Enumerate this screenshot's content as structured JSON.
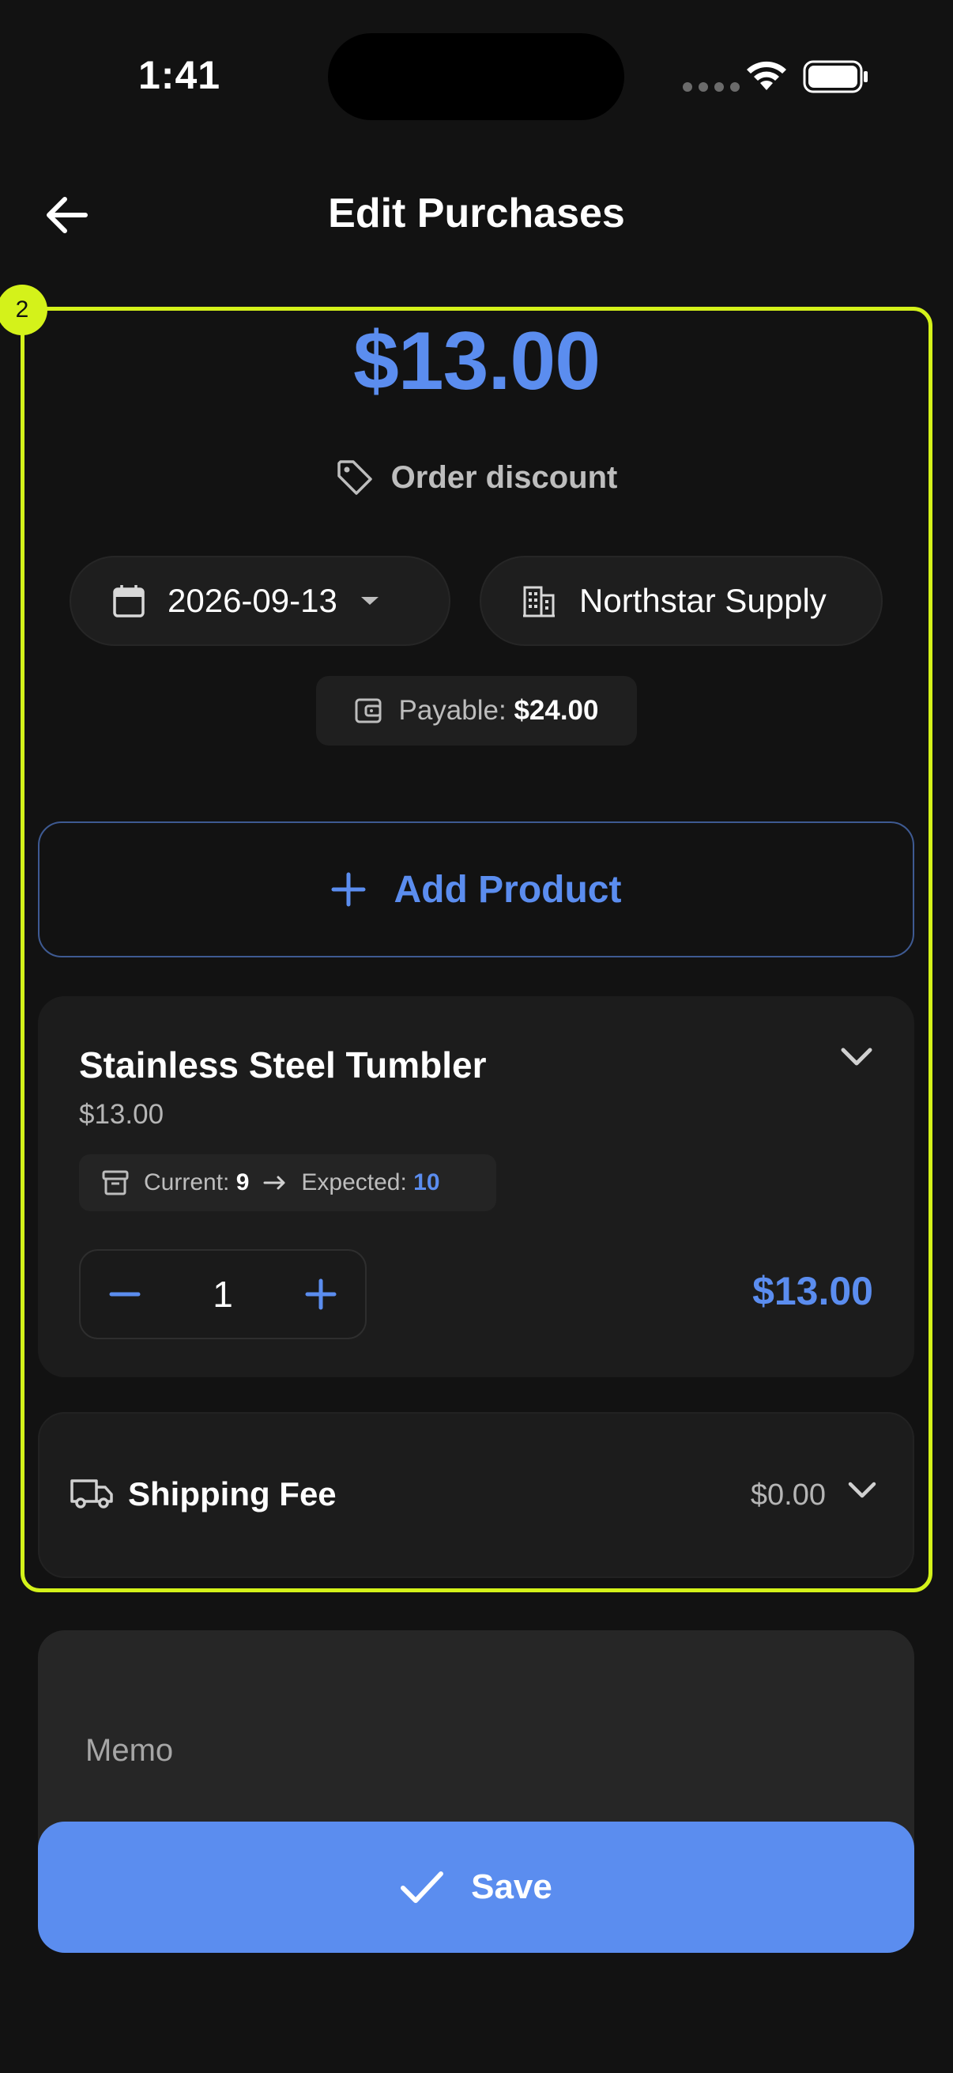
{
  "status": {
    "time": "1:41"
  },
  "header": {
    "title": "Edit Purchases"
  },
  "highlight": {
    "badge": "2"
  },
  "summary": {
    "total": "$13.00",
    "discount_label": "Order discount",
    "date": "2026-09-13",
    "supplier": "Northstar Supply",
    "payable_label": "Payable:",
    "payable_value": "$24.00"
  },
  "actions": {
    "add_product": "Add Product",
    "save": "Save"
  },
  "product": {
    "name": "Stainless Steel Tumbler",
    "unit_price": "$13.00",
    "current_label": "Current:",
    "current_value": "9",
    "expected_label": "Expected:",
    "expected_value": "10",
    "quantity": "1",
    "line_total": "$13.00"
  },
  "shipping": {
    "label": "Shipping Fee",
    "value": "$0.00"
  },
  "memo": {
    "placeholder": "Memo"
  },
  "colors": {
    "accent": "#5b8def",
    "highlight": "#d4f21a",
    "background": "#121212"
  }
}
